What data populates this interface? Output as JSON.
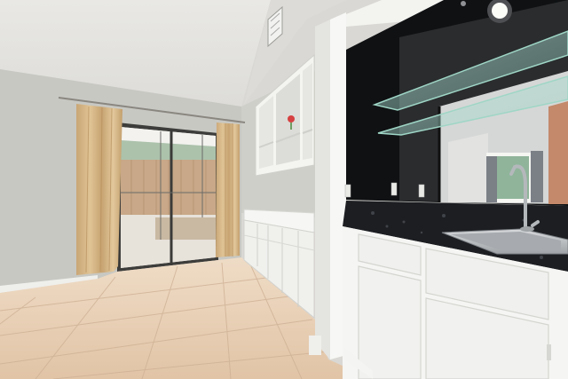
{
  "scene": {
    "kind": "interior-photo",
    "room": "kitchen-wet-bar",
    "colors": {
      "wall": "#c9c9c4",
      "ceiling": "#e6e5e1",
      "floor_tile": "#e3c9ad",
      "cabinet": "#f4f4f2",
      "countertop": "#1c1e22",
      "curtain": "#d8b98c",
      "patio": "#c9b9a2",
      "fence": "#c8a888"
    }
  }
}
